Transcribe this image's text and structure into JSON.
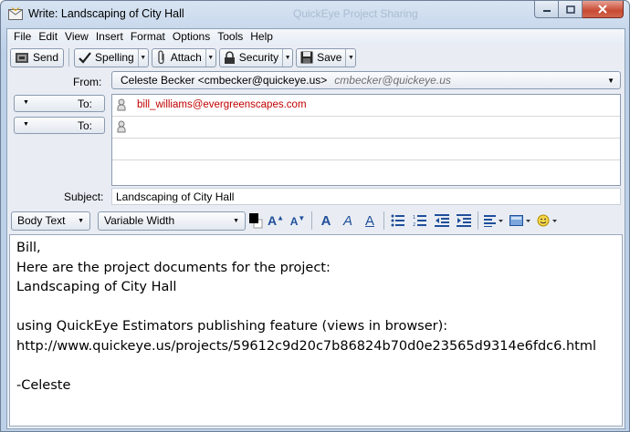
{
  "window": {
    "title": "Write: Landscaping of City Hall",
    "ghost_title": "QuickEye Project Sharing"
  },
  "menu": [
    "File",
    "Edit",
    "View",
    "Insert",
    "Format",
    "Options",
    "Tools",
    "Help"
  ],
  "toolbar": {
    "send": "Send",
    "spelling": "Spelling",
    "attach": "Attach",
    "security": "Security",
    "save": "Save"
  },
  "header": {
    "from_label": "From:",
    "from_value": "Celeste Becker <cmbecker@quickeye.us>",
    "from_ghost": "cmbecker@quickeye.us",
    "to_label_1": "To:",
    "to_label_2": "To:",
    "recipient_1": "bill_williams@evergreenscapes.com",
    "recipient_2": "",
    "subject_label": "Subject:",
    "subject_value": "Landscaping of City Hall"
  },
  "format": {
    "paragraph_style": "Body Text",
    "font": "Variable Width"
  },
  "body": [
    "Bill,",
    "Here are the project documents for the project:",
    "Landscaping of City Hall",
    "",
    "using QuickEye Estimators publishing feature (views in browser):",
    "http://www.quickeye.us/projects/59612c9d20c7b86824b70d0e23565d9314e6fdc6.html",
    "",
    "-Celeste"
  ]
}
